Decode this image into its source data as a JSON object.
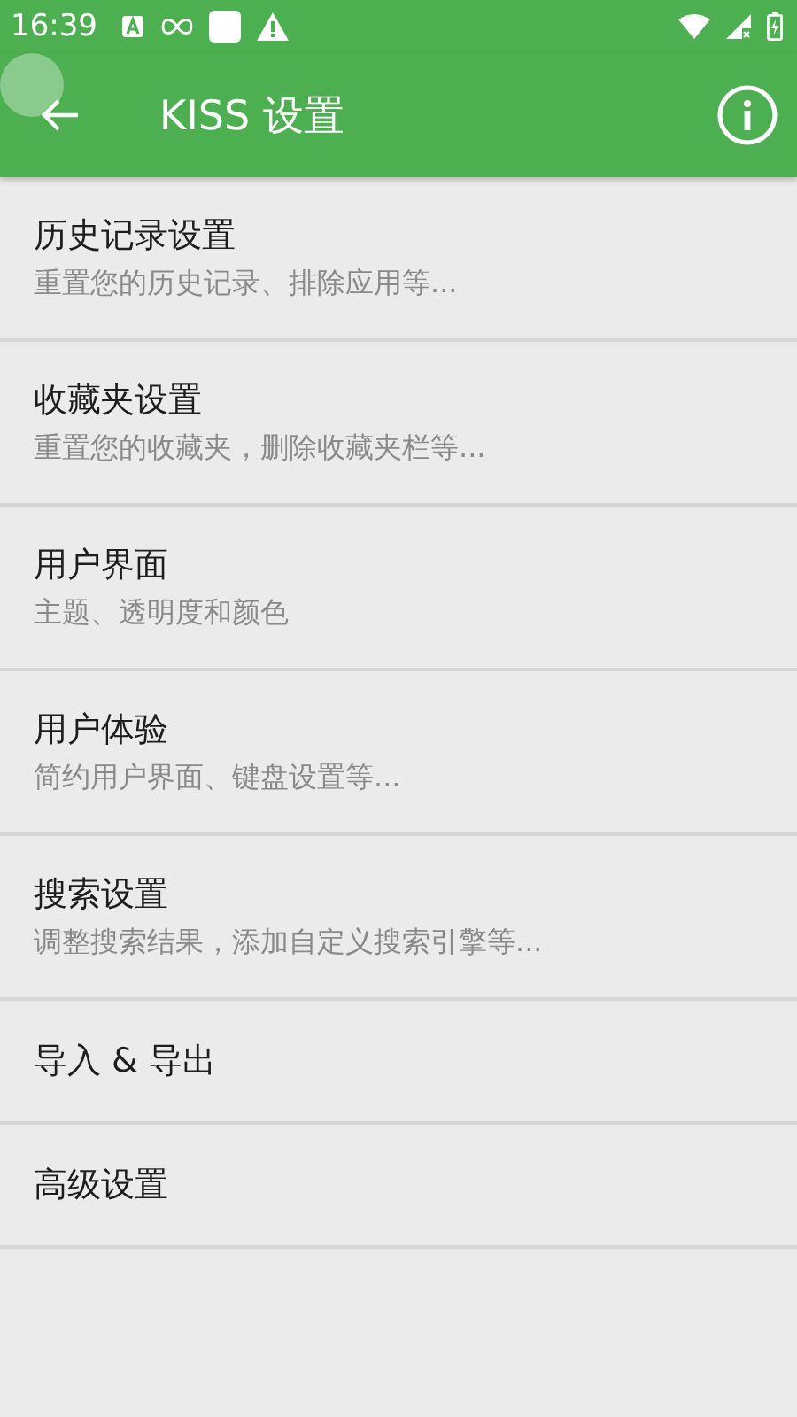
{
  "status_bar": {
    "time": "16:39"
  },
  "app_bar": {
    "title": "KISS 设置"
  },
  "settings": [
    {
      "title": "历史记录设置",
      "summary": "重置您的历史记录、排除应用等..."
    },
    {
      "title": "收藏夹设置",
      "summary": "重置您的收藏夹，删除收藏夹栏等..."
    },
    {
      "title": "用户界面",
      "summary": "主题、透明度和颜色"
    },
    {
      "title": "用户体验",
      "summary": "简约用户界面、键盘设置等..."
    },
    {
      "title": "搜索设置",
      "summary": "调整搜索结果，添加自定义搜索引擎等..."
    },
    {
      "title": "导入 & 导出"
    },
    {
      "title": "高级设置"
    }
  ]
}
